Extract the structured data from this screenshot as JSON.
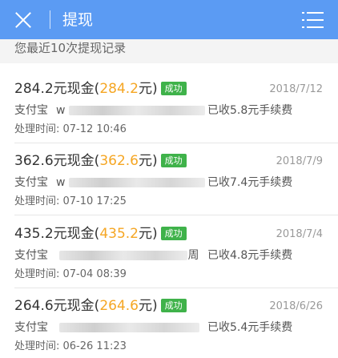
{
  "header": {
    "title": "提现",
    "close_icon": "close-icon",
    "menu_icon": "menu-list-icon",
    "background_color": "#5b9bf3"
  },
  "section": {
    "label": "您最近10次提现记录"
  },
  "records": [
    {
      "amount": "284.2元现金(",
      "amount_highlight": "284.2",
      "amount_suffix": "元)",
      "status": "成功",
      "date": "2018/7/12",
      "method": "支付宝",
      "account_prefix": "w",
      "account_suffix": "",
      "fee": "已收5.8元手续费",
      "processed_time": "处理时间: 07-12 10:46"
    },
    {
      "amount": "362.6元现金(",
      "amount_highlight": "362.6",
      "amount_suffix": "元)",
      "status": "成功",
      "date": "2018/7/9",
      "method": "支付宝",
      "account_prefix": "w",
      "account_suffix": "",
      "fee": "已收7.4元手续费",
      "processed_time": "处理时间: 07-10 17:25"
    },
    {
      "amount": "435.2元现金(",
      "amount_highlight": "435.2",
      "amount_suffix": "元)",
      "status": "成功",
      "date": "2018/7/4",
      "method": "支付宝",
      "account_prefix": "",
      "account_suffix": "周",
      "fee": "已收4.8元手续费",
      "processed_time": "处理时间: 07-04 08:39"
    },
    {
      "amount": "264.6元现金(",
      "amount_highlight": "264.6",
      "amount_suffix": "元)",
      "status": "成功",
      "date": "2018/6/26",
      "method": "支付宝",
      "account_prefix": "",
      "account_suffix": "",
      "fee": "已收5.4元手续费",
      "processed_time": "处理时间: 06-26 11:23"
    }
  ],
  "colors": {
    "highlight": "#f5a623",
    "success_badge": "#3fb24a"
  }
}
